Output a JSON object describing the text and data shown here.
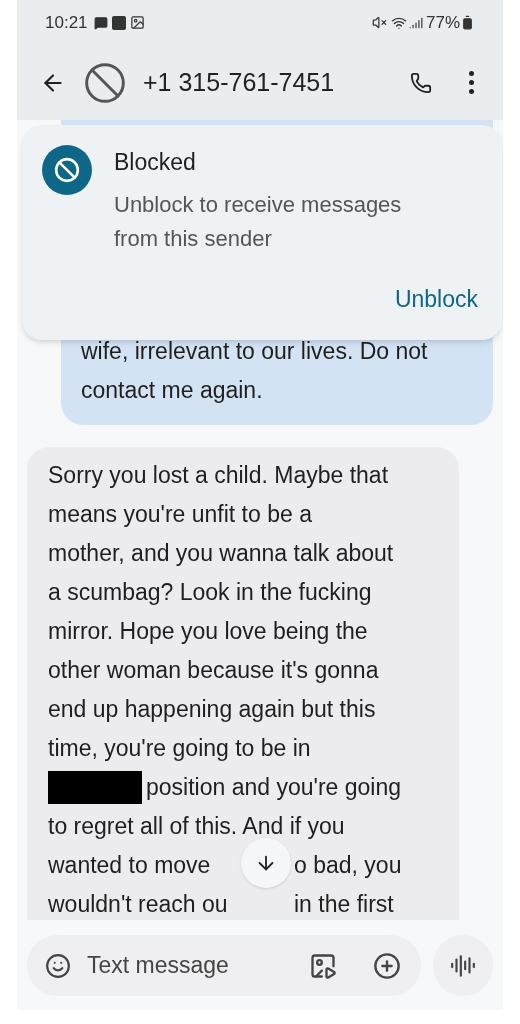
{
  "status_bar": {
    "time": "10:21",
    "battery": "77%"
  },
  "header": {
    "contact": "+1 315-761-7451"
  },
  "blocked_card": {
    "title": "Blocked",
    "body": "Unblock to receive messages from this sender",
    "action": "Unblock"
  },
  "sent_message": {
    "lines": [
      "wife, irrelevant to our lives. Do not",
      "contact me again."
    ]
  },
  "received_message": {
    "lines": [
      {
        "kind": "text",
        "parts": [
          "Sorry you lost a child. Maybe that"
        ]
      },
      {
        "kind": "text",
        "parts": [
          "means you're unfit to be a"
        ]
      },
      {
        "kind": "text",
        "parts": [
          "mother, and you wanna talk about"
        ]
      },
      {
        "kind": "text",
        "parts": [
          "a scumbag? Look in the fucking"
        ]
      },
      {
        "kind": "text",
        "parts": [
          "mirror. Hope you love being the"
        ]
      },
      {
        "kind": "text",
        "parts": [
          "other woman because it's gonna"
        ]
      },
      {
        "kind": "text",
        "parts": [
          "end up happening again but this"
        ]
      },
      {
        "kind": "text",
        "parts": [
          "time, you're going to be in"
        ]
      },
      {
        "kind": "redacted",
        "parts": [
          "position and you're going"
        ]
      },
      {
        "kind": "text",
        "parts": [
          "to regret all of this. And if you"
        ]
      },
      {
        "kind": "covered",
        "parts": [
          "wanted to move",
          "o bad, you"
        ]
      },
      {
        "kind": "covered",
        "parts": [
          "wouldn't reach ou",
          "in the first"
        ]
      }
    ]
  },
  "composer": {
    "placeholder": "Text message"
  }
}
